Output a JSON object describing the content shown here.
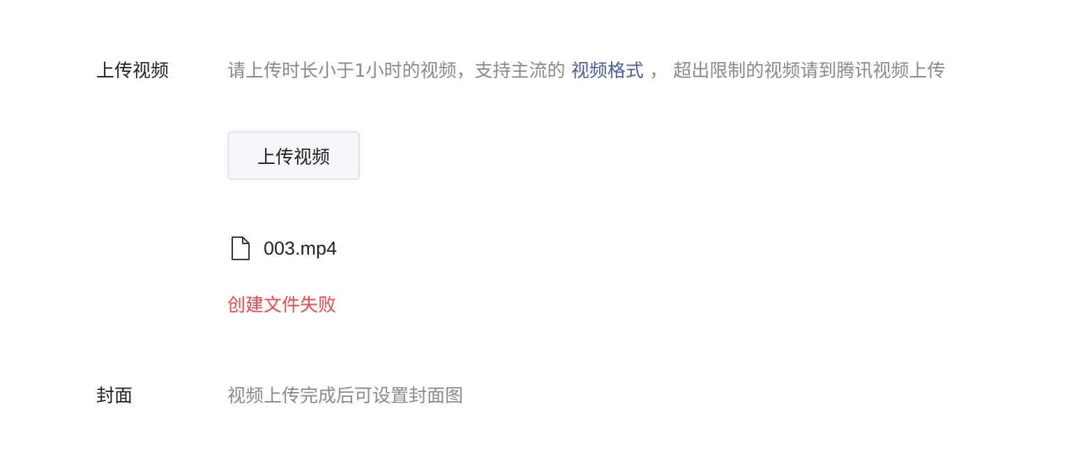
{
  "upload_section": {
    "label": "上传视频",
    "hint_before": "请上传时长小于1小时的视频，支持主流的 ",
    "hint_link": "视频格式",
    "hint_after": " ，  超出限制的视频请到腾讯视频上传",
    "button_label": "上传视频",
    "file": {
      "icon": "file-icon",
      "name": "003.mp4"
    },
    "error": "创建文件失败"
  },
  "cover_section": {
    "label": "封面",
    "hint": "视频上传完成后可设置封面图"
  },
  "colors": {
    "link": "#4a6199",
    "error": "#f0494c",
    "hint": "#8a8a8a"
  }
}
